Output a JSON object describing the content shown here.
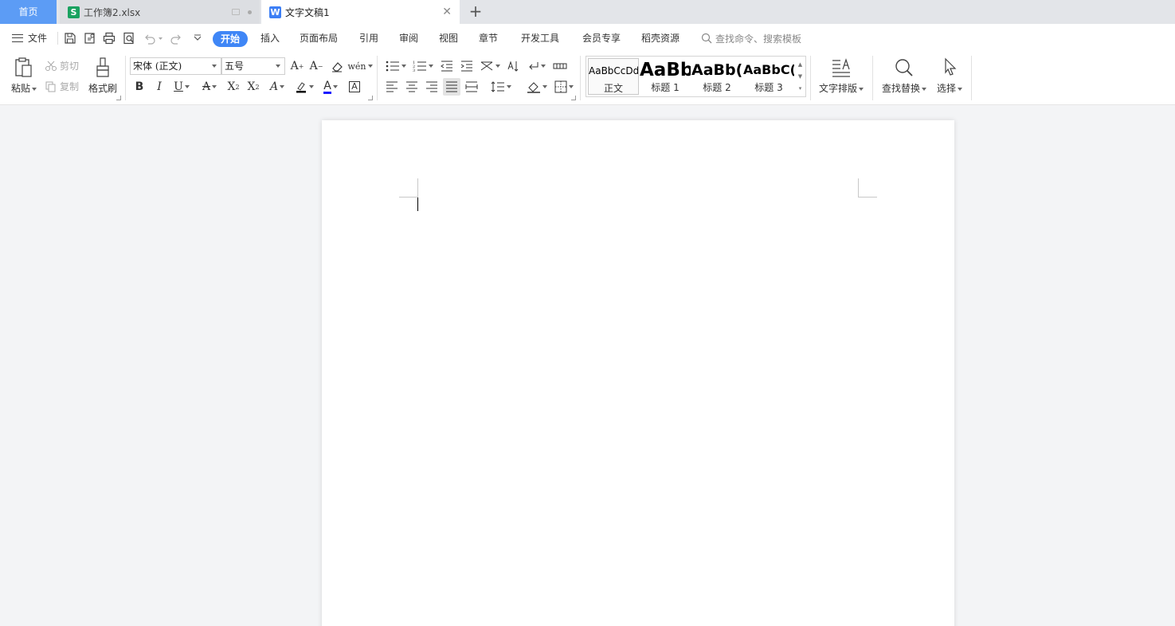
{
  "tabs": {
    "home_label": "首页",
    "sheet": {
      "icon": "S",
      "label": "工作簿2.xlsx"
    },
    "doc": {
      "icon": "W",
      "label": "文字文稿1",
      "close": "✕"
    },
    "add": "+"
  },
  "menu": {
    "file_label": "文件",
    "items": [
      "开始",
      "插入",
      "页面布局",
      "引用",
      "审阅",
      "视图",
      "章节",
      "开发工具",
      "会员专享",
      "稻壳资源"
    ],
    "search_placeholder": "查找命令、搜索模板"
  },
  "ribbon": {
    "paste_label": "粘贴",
    "cut_label": "剪切",
    "copy_label": "复制",
    "format_painter_label": "格式刷",
    "font_name": "宋体 (正文)",
    "font_size": "五号",
    "styles": [
      {
        "preview": "AaBbCcDd",
        "name": "正文"
      },
      {
        "preview": "AaBb",
        "name": "标题 1"
      },
      {
        "preview": "AaBb(",
        "name": "标题 2"
      },
      {
        "preview": "AaBbC(",
        "name": "标题 3"
      }
    ],
    "text_layout_label": "文字排版",
    "find_replace_label": "查找替换",
    "select_label": "选择"
  },
  "colors": {
    "home_tab": "#5c9cf5",
    "active_menu": "#3f86f6",
    "sheet_icon": "#1aa260",
    "doc_icon": "#3d7ff5",
    "font_color": "#1a1aff",
    "highlight": "#000000"
  }
}
